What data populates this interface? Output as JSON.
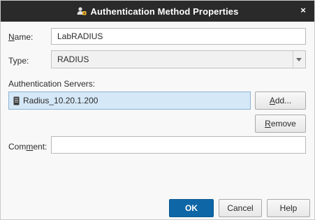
{
  "dialog": {
    "title": "Authentication Method Properties",
    "close_glyph": "×",
    "title_icon": "authentication-method-icon"
  },
  "form": {
    "name": {
      "label": "Name:",
      "value": "LabRADIUS"
    },
    "type": {
      "label": "Type:",
      "value": "RADIUS"
    },
    "servers": {
      "label": "Authentication Servers:",
      "items": [
        {
          "label": "Radius_10.20.1.200",
          "icon": "server-icon"
        }
      ]
    },
    "comment": {
      "label": "Comment:",
      "value": ""
    }
  },
  "buttons": {
    "add": "Add...",
    "remove": "Remove",
    "ok": "OK",
    "cancel": "Cancel",
    "help": "Help"
  },
  "colors": {
    "titlebar": "#2a2a2a",
    "accent": "#0e66a7",
    "selection": "#d5e8f7"
  }
}
